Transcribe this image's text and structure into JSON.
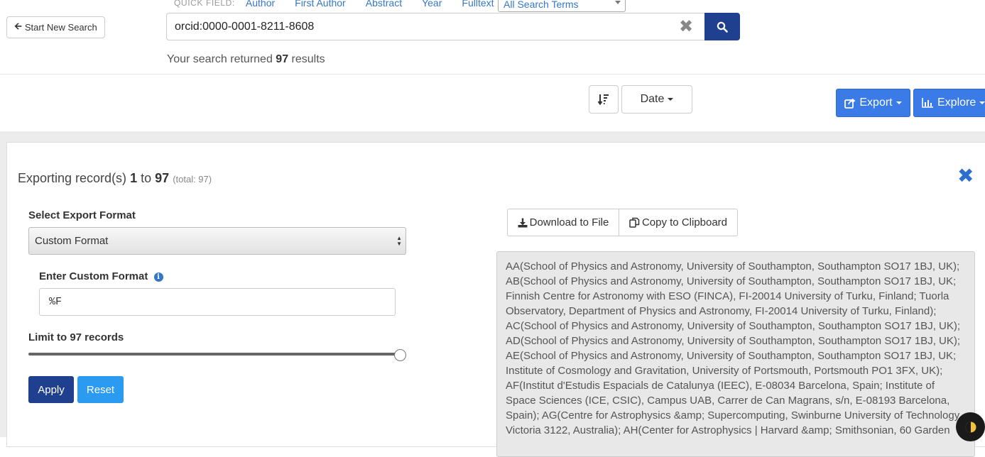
{
  "header": {
    "start_new_search": "Start New Search",
    "quick_field_label": "QUICK FIELD:",
    "quick_fields": [
      "Author",
      "First Author",
      "Abstract",
      "Year",
      "Fulltext"
    ],
    "search_terms_select": "All Search Terms",
    "search_query": "orcid:0000-0001-8211-8608",
    "results_prefix": "Your search returned",
    "results_count": "97",
    "results_suffix": "results"
  },
  "toolbar": {
    "sort_label": "Date",
    "export_label": "Export",
    "explore_label": "Explore"
  },
  "export_panel": {
    "title_prefix": "Exporting record(s)",
    "range_start": "1",
    "range_to": "to",
    "range_end": "97",
    "total_note": "(total: 97)",
    "select_format_label": "Select Export Format",
    "selected_format": "Custom Format",
    "custom_format_label": "Enter Custom Format",
    "custom_format_value": "%F",
    "limit_label": "Limit to 97 records",
    "limit_fraction": 1.0,
    "apply_label": "Apply",
    "reset_label": "Reset",
    "download_label": "Download to File",
    "copy_label": "Copy to Clipboard",
    "output_text": "AA(School of Physics and Astronomy, University of Southampton, Southampton SO17 1BJ, UK); AB(School of Physics and Astronomy, University of Southampton, Southampton SO17 1BJ, UK; Finnish Centre for Astronomy with ESO (FINCA), FI-20014 University of Turku, Finland; Tuorla Observatory, Department of Physics and Astronomy, FI-20014 University of Turku, Finland); AC(School of Physics and Astronomy, University of Southampton, Southampton SO17 1BJ, UK); AD(School of Physics and Astronomy, University of Southampton, Southampton SO17 1BJ, UK); AE(School of Physics and Astronomy, University of Southampton, Southampton SO17 1BJ, UK; Institute of Cosmology and Gravitation, University of Portsmouth, Portsmouth PO1 3FX, UK); AF(Institut d'Estudis Espacials de Catalunya (IEEC), E-08034 Barcelona, Spain; Institute of Space Sciences (ICE, CSIC), Campus UAB, Carrer de Can Magrans, s/n, E-08193 Barcelona, Spain); AG(Centre for Astrophysics &amp; Supercomputing, Swinburne University of Technology, Victoria 3122, Australia); AH(Center for Astrophysics | Harvard &amp; Smithsonian, 60 Garden"
  },
  "colors": {
    "primary_dark": "#1f3f8f",
    "primary": "#3a7be8",
    "link": "#3577c4",
    "reset": "#2a9bf0"
  },
  "icons": [
    "arrow-left-icon",
    "clear-icon",
    "search-icon",
    "sort-icon",
    "share-icon",
    "bar-chart-icon",
    "close-icon",
    "info-icon",
    "download-icon",
    "copy-icon",
    "moon-icon"
  ]
}
